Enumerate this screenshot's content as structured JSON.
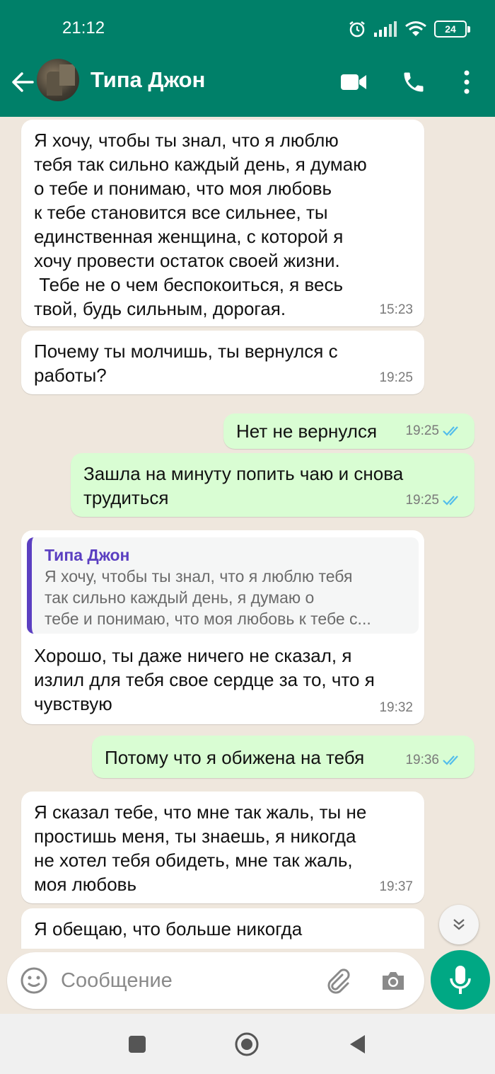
{
  "status_bar": {
    "time": "21:12",
    "battery": "24"
  },
  "header": {
    "contact_name": "Типа Джон"
  },
  "messages": [
    {
      "dir": "in",
      "text": "Я хочу, чтобы ты знал, что я люблю\nтебя так сильно каждый день, я думаю\nо тебе и понимаю, что моя любовь\nк тебе становится все сильнее, ты\nединственная женщина, с которой я\nхочу провести остаток своей жизни.\n Тебе не о чем беспокоиться, я весь\nтвой, будь сильным, дорогая.",
      "time": "15:23"
    },
    {
      "dir": "in",
      "text": "Почему ты молчишь, ты вернулся с\nработы?",
      "time": "19:25"
    },
    {
      "dir": "out",
      "text": "Нет не вернулся",
      "time": "19:25"
    },
    {
      "dir": "out",
      "text": "Зашла на минуту попить чаю и снова\nтрудиться",
      "time": "19:25"
    },
    {
      "dir": "in",
      "quote_name": "Типа Джон",
      "quote_text": "Я хочу, чтобы ты знал, что я люблю тебя\nтак сильно каждый день, я думаю о\nтебе и понимаю, что моя любовь к тебе с...",
      "text": "Хорошо, ты даже ничего не сказал, я\nизлил для тебя свое сердце за то, что я\nчувствую",
      "time": "19:32"
    },
    {
      "dir": "out",
      "text": "Потому что я обижена на тебя",
      "time": "19:36"
    },
    {
      "dir": "in",
      "text": "Я сказал тебе, что мне так жаль, ты не\nпростишь меня, ты знаешь, я никогда\nне хотел тебя обидеть, мне так жаль,\nмоя любовь",
      "time": "19:37"
    },
    {
      "dir": "in",
      "text": "Я обещаю, что больше никогда",
      "time": ""
    }
  ],
  "composer": {
    "placeholder": "Сообщение"
  },
  "colors": {
    "header": "#008069",
    "outgoing": "#d9fdd3",
    "incoming": "#ffffff",
    "read_ticks": "#53bdeb",
    "mic": "#00a884",
    "quote_accent": "#5b3fc1"
  }
}
